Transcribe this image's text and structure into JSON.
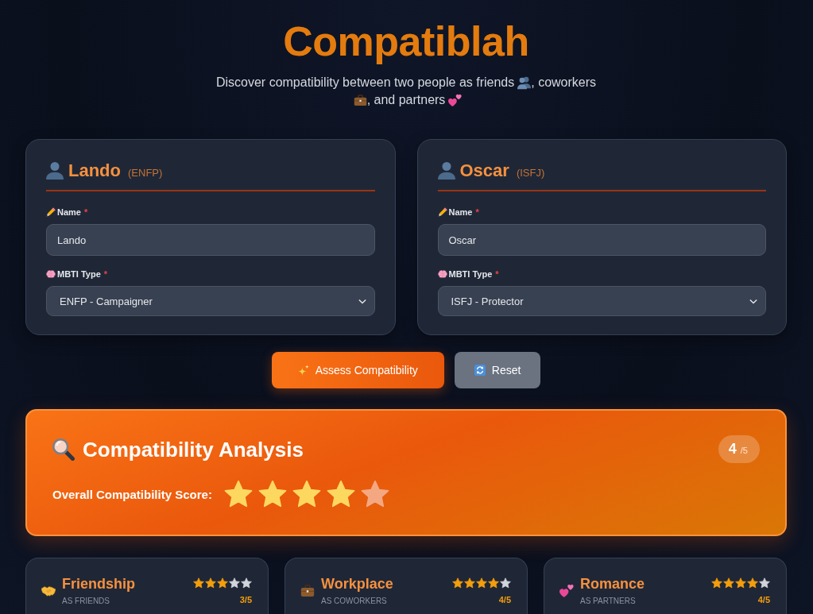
{
  "header": {
    "title": "Compatiblah",
    "subtitle": [
      "Discover compatibility between two people as friends",
      ", coworkers",
      ", and partners"
    ]
  },
  "people": [
    {
      "heading": "Lando",
      "type_tag": "(ENFP)",
      "fields": [
        {
          "kind": "text",
          "label": "Name",
          "required_mark": "*",
          "value": "Lando"
        },
        {
          "kind": "select",
          "label": "MBTI Type",
          "required_mark": "*",
          "value": "ENFP - Campaigner"
        }
      ]
    },
    {
      "heading": "Oscar",
      "type_tag": "(ISFJ)",
      "fields": [
        {
          "kind": "text",
          "label": "Name",
          "required_mark": "*",
          "value": "Oscar"
        },
        {
          "kind": "select",
          "label": "MBTI Type",
          "required_mark": "*",
          "value": "ISFJ - Protector"
        }
      ]
    }
  ],
  "actions": [
    {
      "kind": "primary",
      "label": "Assess Compatibility"
    },
    {
      "kind": "secondary",
      "label": "Reset"
    }
  ],
  "results": {
    "title": "Compatibility Analysis",
    "score": "4",
    "score_max": "/5",
    "overall_label": "Overall Compatibility Score:",
    "stars": 4
  },
  "categories": [
    {
      "title": "Friendship",
      "subtitle": "AS FRIENDS",
      "stars": 3,
      "score": "3/5"
    },
    {
      "title": "Workplace",
      "subtitle": "AS COWORKERS",
      "stars": 4,
      "score": "4/5"
    },
    {
      "title": "Romance",
      "subtitle": "AS PARTNERS",
      "stars": 4,
      "score": "4/5"
    }
  ]
}
